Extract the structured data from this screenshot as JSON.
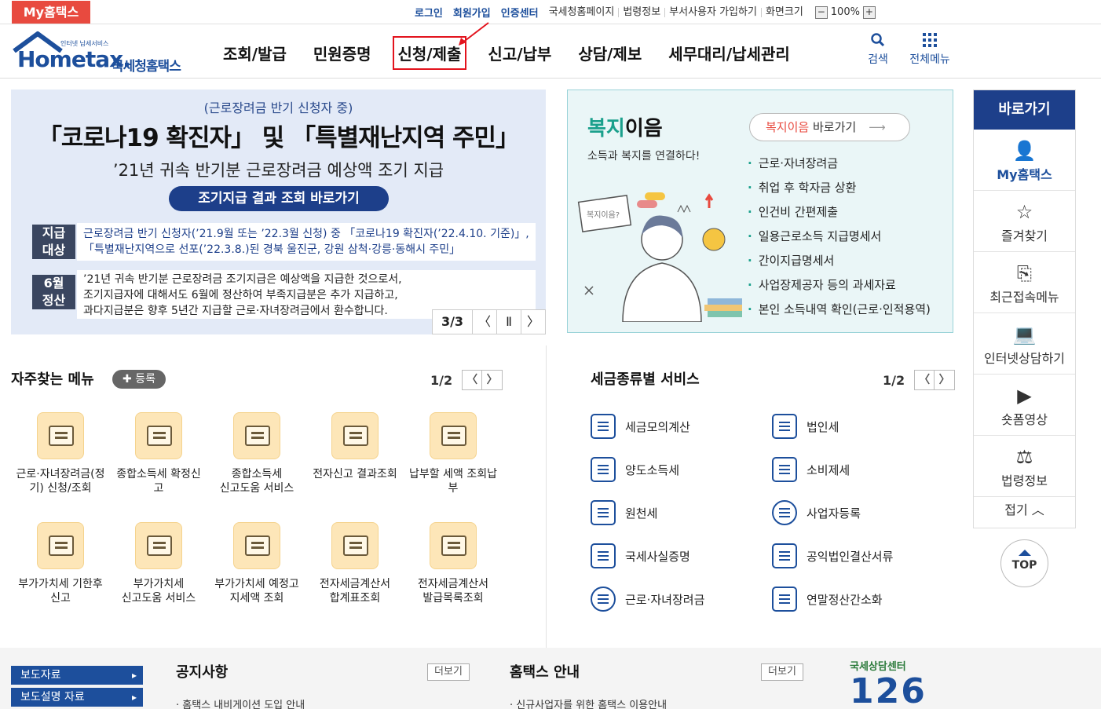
{
  "topbar": {
    "my_hometax": "My홈택스",
    "links": [
      "로그인",
      "회원가입",
      "인증센터"
    ],
    "utils": [
      "국세청홈페이지",
      "법령정보",
      "부서사용자 가입하기",
      "화면크기"
    ],
    "zoom_minus": "−",
    "zoom_value": "100%",
    "zoom_plus": "+"
  },
  "header": {
    "logo_sub": "인터넷 납세서비스",
    "logo_main": "Hometax.",
    "logo_kr": "국세청홈택스",
    "nav": [
      "조회/발급",
      "민원증명",
      "신청/제출",
      "신고/납부",
      "상담/제보",
      "세무대리/납세관리"
    ],
    "search_label": "검색",
    "menu_label": "전체메뉴"
  },
  "banner": {
    "line1": "(근로장려금 반기 신청자 중)",
    "line2": "「코로나19 확진자」 및 「특별재난지역 주민」",
    "line3": "’21년 귀속 반기분 근로장려금 예상액 조기 지급",
    "button": "조기지급 결과 조회 바로가기",
    "tag1": "지급\n대상",
    "tag1_a": "지급",
    "tag1_b": "대상",
    "row1_a": "근로장려금 반기 신청자(’21.9월 또는 ’22.3월 신청) 중 「코로나19 확진자(’22.4.10. 기준)」,",
    "row1_b": "「특별재난지역으로 선포(’22.3.8.)된 경북 울진군, 강원 삼척·강릉·동해시 주민」",
    "tag2_a": "6월",
    "tag2_b": "정산",
    "row2_a": "’21년 귀속 반기분 근로장려금 조기지급은 예상액을 지급한 것으로서,",
    "row2_b": "조기지급자에 대해서도 6월에 정산하여 부족지급분은 추가 지급하고,",
    "row2_c": "과다지급분은 향후 5년간 지급할 근로·자녀장려금에서 환수합니다.",
    "pager": "3/3",
    "prev": "〈",
    "pause": "Ⅱ",
    "next": "〉"
  },
  "welfare": {
    "title_a": "복지",
    "title_b": "이음",
    "subtitle": "소득과 복지를 연결하다!",
    "btn_a": "복지이음",
    "btn_b": " 바로가기",
    "bubble": "복지이음?",
    "items": [
      "근로·자녀장려금",
      "취업 후 학자금 상환",
      "인건비 간편제출",
      "일용근로소득 지급명세서",
      "간이지급명세서",
      "사업장제공자 등의 과세자료",
      "본인 소득내역 확인(근로·인적용역)"
    ]
  },
  "quick": {
    "header": "바로가기",
    "items": [
      "My홈택스",
      "즐겨찾기",
      "최근접속메뉴",
      "인터넷상담하기",
      "숏폼영상",
      "법령정보"
    ],
    "fold": "접기 ︿",
    "top": "TOP"
  },
  "frequent": {
    "title": "자주찾는 메뉴",
    "register": "✚ 등록",
    "page": "1/2",
    "items": [
      [
        "근로·자녀장려금(정",
        "기) 신청/조회"
      ],
      [
        "종합소득세 확정신",
        "고"
      ],
      [
        "종합소득세",
        "신고도움 서비스"
      ],
      [
        "전자신고 결과조회",
        ""
      ],
      [
        "납부할 세액 조회납",
        "부"
      ],
      [
        "부가가치세 기한후",
        "신고"
      ],
      [
        "부가가치세",
        "신고도움 서비스"
      ],
      [
        "부가가치세 예정고",
        "지세액 조회"
      ],
      [
        "전자세금계산서",
        "합계표조회"
      ],
      [
        "전자세금계산서",
        "발급목록조회"
      ]
    ]
  },
  "taxsvc": {
    "title": "세금종류별 서비스",
    "page": "1/2",
    "left": [
      "세금모의계산",
      "양도소득세",
      "원천세",
      "국세사실증명",
      "근로·자녀장려금"
    ],
    "right": [
      "법인세",
      "소비제세",
      "사업자등록",
      "공익법인결산서류",
      "연말정산간소화"
    ]
  },
  "bottom": {
    "press": "보도자료",
    "press2": "보도설명 자료",
    "notice": "공지사항",
    "notice_more": "더보기",
    "notice_item": "홈택스 내비게이션 도입 안내",
    "guide": "홈택스 안내",
    "guide_more": "더보기",
    "guide_item": "신규사업자를 위한 홈택스 이용안내",
    "center": "국세상담센터",
    "center_num": "126"
  },
  "colors": {
    "brand": "#1d4f9c",
    "accent": "#e84a3f",
    "highlight": "#e3131d"
  }
}
